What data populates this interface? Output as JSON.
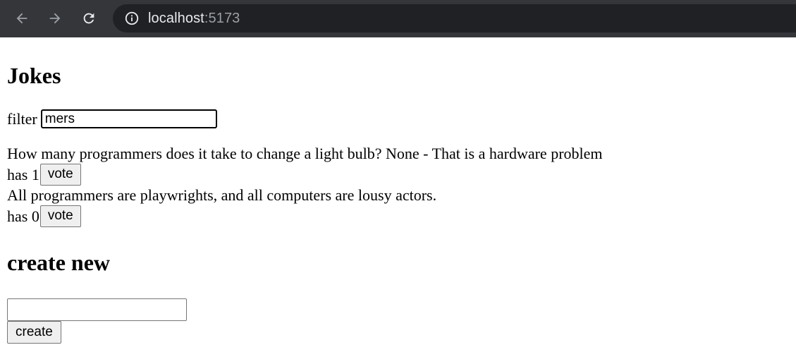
{
  "browser": {
    "url_host": "localhost",
    "url_port": ":5173",
    "icons": {
      "back": "arrow-left-icon",
      "forward": "arrow-right-icon",
      "reload": "reload-icon",
      "site_info": "info-icon"
    }
  },
  "page": {
    "title": "Jokes",
    "filter": {
      "label": "filter",
      "value": "mers"
    },
    "jokes": [
      {
        "text": "How many programmers does it take to change a light bulb? None - That is a hardware problem",
        "votes_prefix": "has 1",
        "vote_label": "vote"
      },
      {
        "text": "All programmers are playwrights, and all computers are lousy actors.",
        "votes_prefix": "has 0",
        "vote_label": "vote"
      }
    ],
    "create": {
      "heading": "create new",
      "input_value": "",
      "button_label": "create"
    }
  }
}
